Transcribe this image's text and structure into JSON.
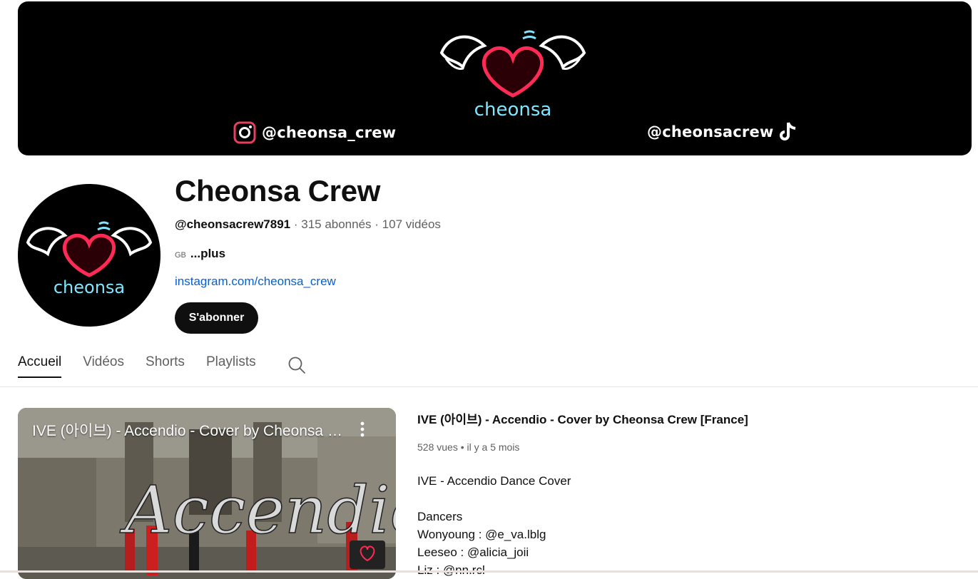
{
  "banner": {
    "logo_text": "cheonsa",
    "instagram_handle": "@cheonsa_crew",
    "tiktok_handle": "@cheonsacrew"
  },
  "avatar": {
    "logo_text": "cheonsa"
  },
  "channel": {
    "name": "Cheonsa Crew",
    "handle": "@cheonsacrew7891",
    "separator": " · ",
    "subscribers": "315 abonnés",
    "videos": "107 vidéos",
    "description_prefix": "GB",
    "more_label": "...plus",
    "link": "instagram.com/cheonsa_crew",
    "subscribe_label": "S'abonner"
  },
  "tabs": [
    {
      "label": "Accueil",
      "active": true
    },
    {
      "label": "Vidéos",
      "active": false
    },
    {
      "label": "Shorts",
      "active": false
    },
    {
      "label": "Playlists",
      "active": false
    }
  ],
  "featured_video": {
    "thumbnail_title": "IVE (아이브) - Accendio - Cover by Cheonsa Crew [France]",
    "thumbnail_overlay_text": "Accendio",
    "title": "IVE (아이브) - Accendio - Cover by Cheonsa Crew [France]",
    "views": "528 vues",
    "age": "il y a 5 mois",
    "description": [
      "IVE - Accendio Dance Cover",
      "",
      "Dancers",
      "Wonyoung : @e_va.lblg",
      "Leeseo : @alicia_joii",
      "Liz : @nn.rcl"
    ]
  },
  "colors": {
    "brand_red": "#ff2a55",
    "neon_cyan": "#7fe6ff",
    "link_blue": "#065fd4",
    "text_primary": "#0f0f0f",
    "text_secondary": "#606060"
  }
}
